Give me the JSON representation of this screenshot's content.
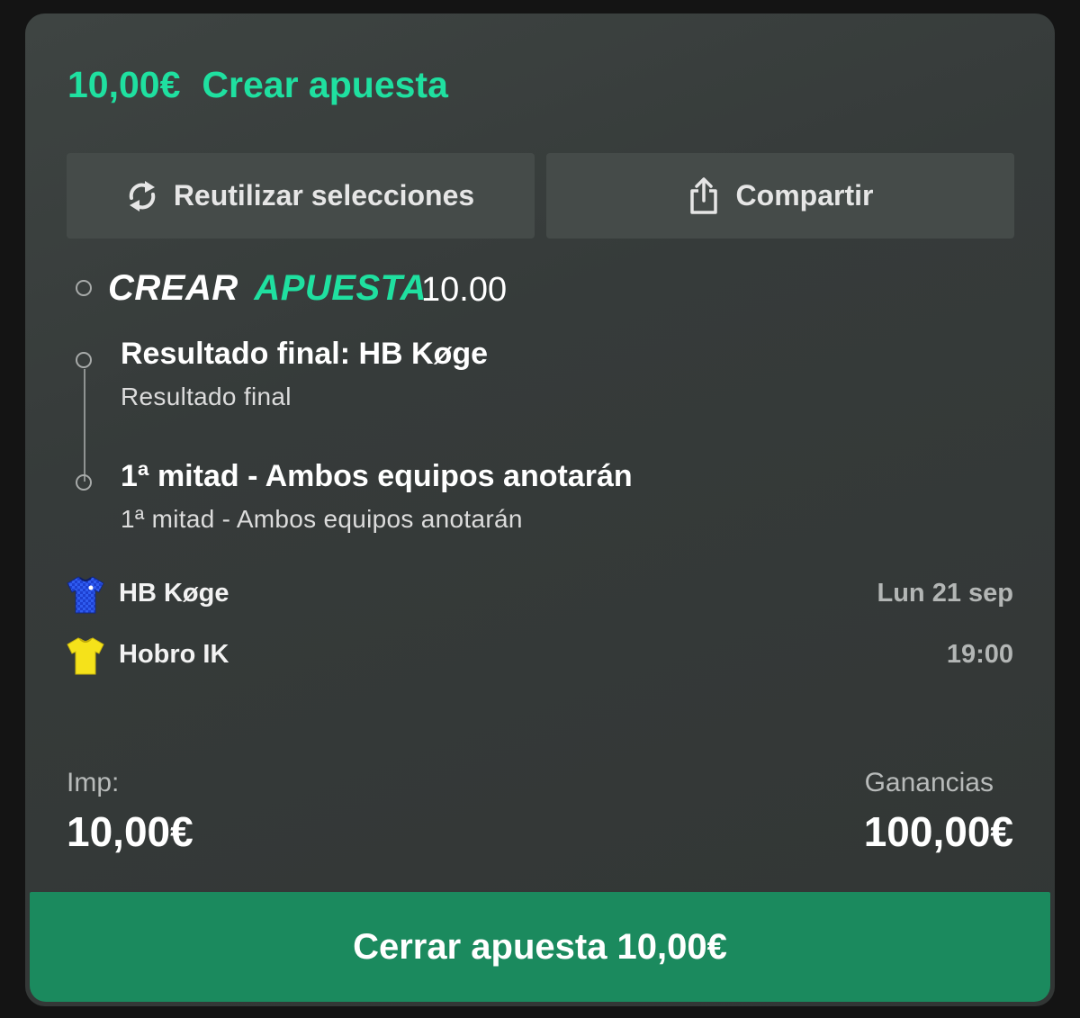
{
  "header": {
    "amount": "10,00€",
    "title": "Crear apuesta"
  },
  "actions": {
    "reuse_label": "Reutilizar selecciones",
    "share_label": "Compartir",
    "reuse_icon": "refresh-icon",
    "share_icon": "share-icon"
  },
  "bet_builder": {
    "title_word1": "CREAR",
    "title_word2": "APUESTA",
    "odds": "10.00",
    "selections": [
      {
        "title": "Resultado final: HB Køge",
        "subtitle": "Resultado final"
      },
      {
        "title": "1ª mitad - Ambos equipos anotarán",
        "subtitle": "1ª mitad - Ambos equipos anotarán"
      }
    ]
  },
  "match": {
    "teams": [
      {
        "name": "HB Køge",
        "meta": "Lun 21 sep",
        "shirt_color": "#1d3fd0"
      },
      {
        "name": "Hobro IK",
        "meta": "19:00",
        "shirt_color": "#f5e21a"
      }
    ]
  },
  "totals": {
    "stake_label": "Imp:",
    "stake_value": "10,00€",
    "winnings_label": "Ganancias",
    "winnings_value": "100,00€"
  },
  "cashout": {
    "label": "Cerrar apuesta 10,00€"
  },
  "colors": {
    "accent": "#1fe0a0",
    "cashout_bg": "#1b8a5e",
    "card_bg": "#373c3b"
  }
}
